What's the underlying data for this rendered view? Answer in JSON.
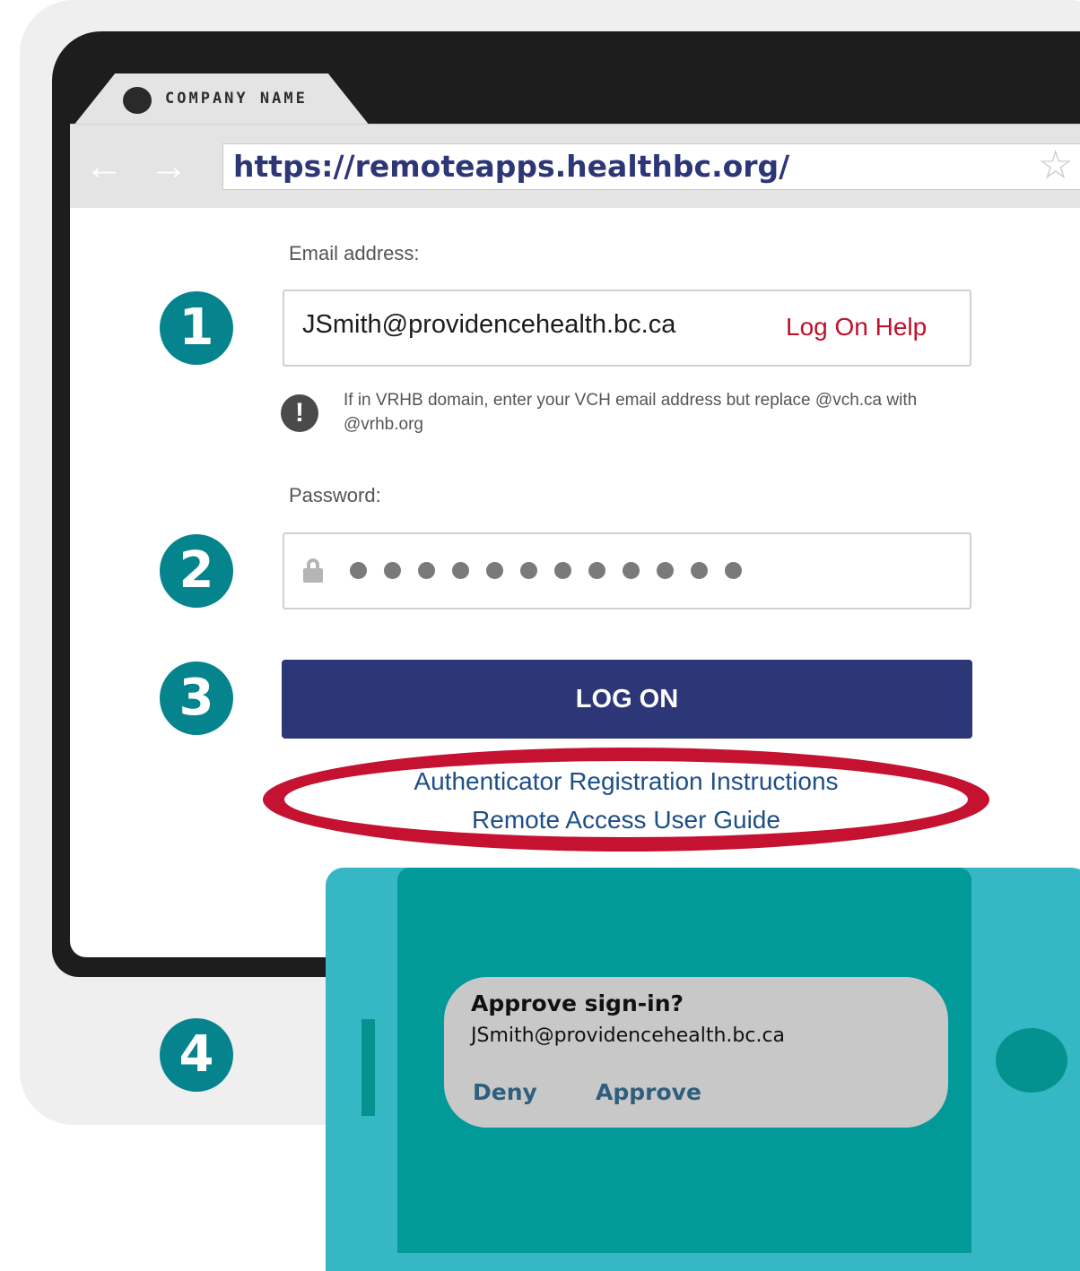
{
  "browser": {
    "tab_title": "COMPANY NAME",
    "url": "https://remoteapps.healthbc.org/"
  },
  "icons": {
    "back": "back-arrow-icon",
    "forward": "forward-arrow-icon",
    "bookmark": "star-icon",
    "alert": "exclamation-icon",
    "lock": "lock-icon"
  },
  "form": {
    "email_label": "Email address:",
    "email_value": "JSmith@providencehealth.bc.ca",
    "log_on_help": "Log On Help",
    "hint": "If in VRHB domain, enter your VCH email address but replace @vch.ca with @vrhb.org",
    "password_label": "Password:",
    "password_mask_count": 12,
    "logon_button": "LOG ON"
  },
  "links": {
    "authenticator": "Authenticator Registration Instructions",
    "user_guide": "Remote Access User Guide"
  },
  "steps": [
    "1",
    "2",
    "3",
    "4"
  ],
  "phone": {
    "notification_title": "Approve sign-in?",
    "notification_email": "JSmith@providencehealth.bc.ca",
    "deny_label": "Deny",
    "approve_label": "Approve"
  },
  "colors": {
    "step_badge": "#06848d",
    "button_navy": "#2d3677",
    "highlight_red": "#c41230",
    "phone_body": "#36b7c4",
    "phone_screen": "#029a99"
  }
}
